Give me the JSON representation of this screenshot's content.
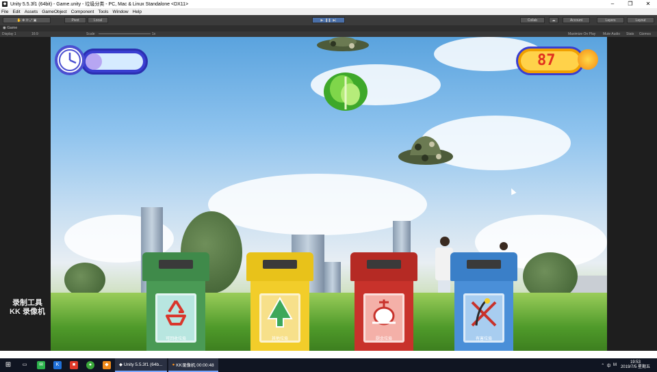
{
  "window": {
    "title": "Unity 5.5.3f1 (64bit) - Game.unity - 垃圾分类 - PC, Mac & Linux Standalone <DX11>"
  },
  "menu": [
    "File",
    "Edit",
    "Assets",
    "GameObject",
    "Component",
    "Tools",
    "Window",
    "Help"
  ],
  "toolbar": {
    "pivot_label": "Pivot",
    "local_label": "Local",
    "collab_label": "Collab",
    "account_label": "Account",
    "layers_label": "Layers",
    "layout_label": "Layout"
  },
  "game_panel": {
    "tab_label": "Game",
    "display_label": "Display 1",
    "aspect_label": "16:9",
    "scale_label": "Scale",
    "scale_value": "1x",
    "maximize_label": "Maximize On Play",
    "mute_label": "Mute Audio",
    "stats_label": "Stats",
    "gizmos_label": "Gizmos"
  },
  "hud": {
    "timer_fraction": 0.28,
    "score": "87"
  },
  "bins": [
    {
      "label": "可回收垃圾",
      "icon": "recycle-icon",
      "lid_color": "#3f8a4a",
      "body_color": "#4a9a55"
    },
    {
      "label": "其他垃圾",
      "icon": "other-waste-icon",
      "lid_color": "#e8c21a",
      "body_color": "#f2cd2a"
    },
    {
      "label": "厨余垃圾",
      "icon": "kitchen-waste-icon",
      "lid_color": "#b52a24",
      "body_color": "#c8322b"
    },
    {
      "label": "有害垃圾",
      "icon": "hazardous-waste-icon",
      "lid_color": "#3a7fc8",
      "body_color": "#4a8fd8"
    }
  ],
  "watermark": {
    "line1": "录制工具",
    "line2": "KK 录像机"
  },
  "taskbar": {
    "tasks": [
      "Unity 5.5.3f1 (64b...",
      "KK录像机 00:00:48"
    ],
    "tray_lang": "中",
    "time": "19:53",
    "date": "2019/7/5 星期五"
  }
}
